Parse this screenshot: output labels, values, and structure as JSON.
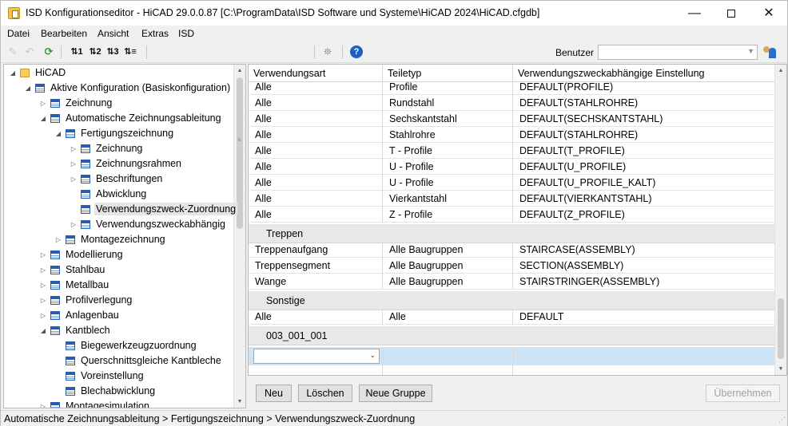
{
  "window": {
    "title": "ISD Konfigurationseditor - HiCAD 29.0.0.87 [C:\\ProgramData\\ISD Software und Systeme\\HiCAD 2024\\HiCAD.cfgdb]",
    "minimize_glyph": "—",
    "close_glyph": "✕"
  },
  "menu": [
    "Datei",
    "Bearbeiten",
    "Ansicht",
    "Extras",
    "ISD"
  ],
  "toolbar": {
    "benutzer_label": "Benutzer",
    "benutzer_value": "",
    "icons": [
      "pencil-icon",
      "undo-icon",
      "refresh-icon",
      "level1-icon",
      "level2-icon",
      "level3-icon",
      "level-all-icon",
      "binoculars-icon",
      "help-icon",
      "users-icon"
    ]
  },
  "tree": [
    {
      "label": "HiCAD",
      "level": 0,
      "state": "open",
      "icon": "folder"
    },
    {
      "label": "Aktive Konfiguration (Basiskonfiguration)",
      "level": 1,
      "state": "open",
      "icon": "table"
    },
    {
      "label": "Zeichnung",
      "level": 2,
      "state": "closed",
      "icon": "table"
    },
    {
      "label": "Automatische Zeichnungsableitung",
      "level": 2,
      "state": "open",
      "icon": "table"
    },
    {
      "label": "Fertigungszeichnung",
      "level": 3,
      "state": "open",
      "icon": "table"
    },
    {
      "label": "Zeichnung",
      "level": 4,
      "state": "closed",
      "icon": "table"
    },
    {
      "label": "Zeichnungsrahmen",
      "level": 4,
      "state": "closed",
      "icon": "table"
    },
    {
      "label": "Beschriftungen",
      "level": 4,
      "state": "closed",
      "icon": "table"
    },
    {
      "label": "Abwicklung",
      "level": 4,
      "state": "leaf",
      "icon": "table"
    },
    {
      "label": "Verwendungszweck-Zuordnung",
      "level": 4,
      "state": "leaf",
      "icon": "table",
      "selected": true
    },
    {
      "label": "Verwendungszweckabhängig",
      "level": 4,
      "state": "closed",
      "icon": "table"
    },
    {
      "label": "Montagezeichnung",
      "level": 3,
      "state": "closed",
      "icon": "table"
    },
    {
      "label": "Modellierung",
      "level": 2,
      "state": "closed",
      "icon": "table"
    },
    {
      "label": "Stahlbau",
      "level": 2,
      "state": "closed",
      "icon": "table"
    },
    {
      "label": "Metallbau",
      "level": 2,
      "state": "closed",
      "icon": "table"
    },
    {
      "label": "Profilverlegung",
      "level": 2,
      "state": "closed",
      "icon": "table"
    },
    {
      "label": "Anlagenbau",
      "level": 2,
      "state": "closed",
      "icon": "table"
    },
    {
      "label": "Kantblech",
      "level": 2,
      "state": "open",
      "icon": "table"
    },
    {
      "label": "Biegewerkzeugzuordnung",
      "level": 3,
      "state": "leaf",
      "icon": "table"
    },
    {
      "label": "Querschnittsgleiche Kantbleche",
      "level": 3,
      "state": "leaf",
      "icon": "table"
    },
    {
      "label": "Voreinstellung",
      "level": 3,
      "state": "leaf",
      "icon": "table"
    },
    {
      "label": "Blechabwicklung",
      "level": 3,
      "state": "leaf",
      "icon": "table"
    },
    {
      "label": "Montagesimulation",
      "level": 2,
      "state": "closed",
      "icon": "table"
    }
  ],
  "grid": {
    "columns": [
      "Verwendungsart",
      "Teiletyp",
      "Verwendungszweckabhängige Einstellung"
    ],
    "rows": [
      {
        "type": "row",
        "cells": [
          "Alle",
          "Profile",
          "DEFAULT(PROFILE)"
        ]
      },
      {
        "type": "row",
        "cells": [
          "Alle",
          "Rundstahl",
          "DEFAULT(STAHLROHRE)"
        ]
      },
      {
        "type": "row",
        "cells": [
          "Alle",
          "Sechskantstahl",
          "DEFAULT(SECHSKANTSTAHL)"
        ]
      },
      {
        "type": "row",
        "cells": [
          "Alle",
          "Stahlrohre",
          "DEFAULT(STAHLROHRE)"
        ]
      },
      {
        "type": "row",
        "cells": [
          "Alle",
          "T - Profile",
          "DEFAULT(T_PROFILE)"
        ]
      },
      {
        "type": "row",
        "cells": [
          "Alle",
          "U - Profile",
          "DEFAULT(U_PROFILE)"
        ]
      },
      {
        "type": "row",
        "cells": [
          "Alle",
          "U - Profile",
          "DEFAULT(U_PROFILE_KALT)"
        ]
      },
      {
        "type": "row",
        "cells": [
          "Alle",
          "Vierkantstahl",
          "DEFAULT(VIERKANTSTAHL)"
        ]
      },
      {
        "type": "row",
        "cells": [
          "Alle",
          "Z - Profile",
          "DEFAULT(Z_PROFILE)"
        ]
      },
      {
        "type": "group",
        "label": "Treppen"
      },
      {
        "type": "row",
        "cells": [
          "Treppenaufgang",
          "Alle Baugruppen",
          "STAIRCASE(ASSEMBLY)"
        ]
      },
      {
        "type": "row",
        "cells": [
          "Treppensegment",
          "Alle Baugruppen",
          "SECTION(ASSEMBLY)"
        ]
      },
      {
        "type": "row",
        "cells": [
          "Wange",
          "Alle Baugruppen",
          "STAIRSTRINGER(ASSEMBLY)"
        ]
      },
      {
        "type": "group",
        "label": "Sonstige"
      },
      {
        "type": "row",
        "cells": [
          "Alle",
          "Alle",
          "DEFAULT"
        ]
      },
      {
        "type": "group",
        "label": "003_001_001"
      },
      {
        "type": "new",
        "cells": [
          "",
          "",
          ""
        ]
      },
      {
        "type": "row",
        "cells": [
          "",
          "",
          ""
        ]
      }
    ]
  },
  "buttons": {
    "neu": "Neu",
    "loeschen": "Löschen",
    "neue_gruppe": "Neue Gruppe",
    "uebernehmen": "Übernehmen"
  },
  "status": {
    "path": "Automatische Zeichnungsableitung > Fertigungszeichnung > Verwendungszweck-Zuordnung"
  }
}
